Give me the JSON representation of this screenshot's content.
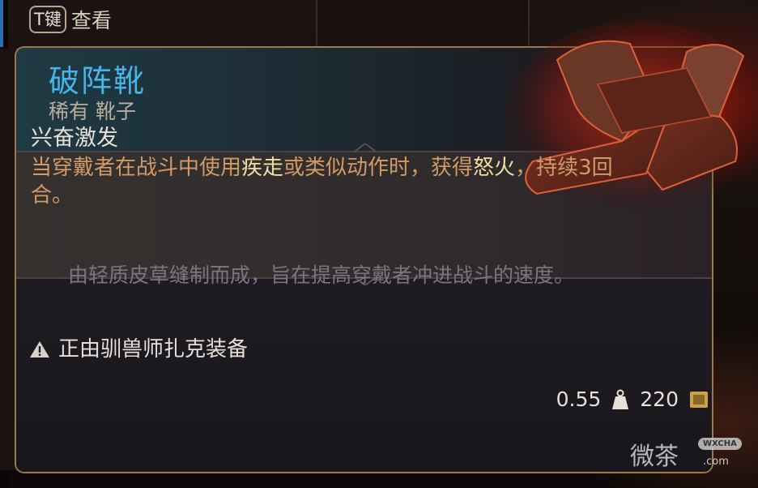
{
  "hint": {
    "key": "T键",
    "label": "查看"
  },
  "item": {
    "name": "破阵靴",
    "subtitle": "稀有 靴子",
    "name_color": "#47b4e8"
  },
  "effect": {
    "title": "兴奋激发",
    "desc_part1": "当穿戴者在战斗中使用",
    "desc_highlight1": "疾走",
    "desc_part2": "或类似动作时，获得",
    "desc_highlight2": "怒火",
    "desc_part3": "，持续3回合。"
  },
  "lore": "由轻质皮草缝制而成，旨在提高穿戴者冲进战斗的速度。",
  "equipped": "正由驯兽师扎克装备",
  "footer": {
    "weight": "0.55",
    "price": "220"
  },
  "watermark": {
    "text": "微茶",
    "badge": "WXCHA",
    "url": ".com"
  },
  "icons": [
    "boots-icon",
    "warning-icon",
    "weight-icon",
    "gold-icon"
  ],
  "colors": {
    "accent_border": "#a07845",
    "effect_text": "#d29a66",
    "highlight_text": "#f0dfa0"
  }
}
